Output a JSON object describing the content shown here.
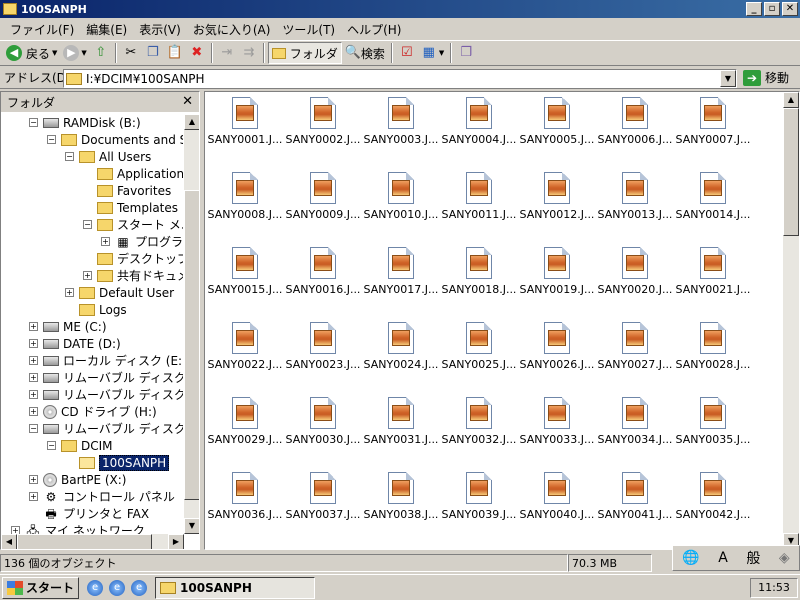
{
  "window": {
    "title": "100SANPH",
    "min": "_",
    "restore": "▫",
    "close": "✕"
  },
  "menu": [
    "ファイル(F)",
    "編集(E)",
    "表示(V)",
    "お気に入り(A)",
    "ツール(T)",
    "ヘルプ(H)"
  ],
  "toolbar": {
    "back": "戻る",
    "folders": "フォルダ",
    "search": "検索"
  },
  "address": {
    "label": "アドレス(D)",
    "value": "I:¥DCIM¥100SANPH",
    "go": "移動"
  },
  "folders_pane": {
    "title": "フォルダ",
    "close": "✕",
    "tree": [
      {
        "label": "RAMDisk (B:)",
        "kind": "drive",
        "exp": "−",
        "level": 1
      },
      {
        "label": "Documents and Set",
        "kind": "folder",
        "exp": "−",
        "level": 2
      },
      {
        "label": "All Users",
        "kind": "folder",
        "exp": "−",
        "level": 3
      },
      {
        "label": "Application",
        "kind": "folder",
        "exp": "",
        "level": 4
      },
      {
        "label": "Favorites",
        "kind": "folder",
        "exp": "",
        "level": 4
      },
      {
        "label": "Templates",
        "kind": "folder",
        "exp": "",
        "level": 4
      },
      {
        "label": "スタート メニュ",
        "kind": "folder",
        "exp": "−",
        "level": 4
      },
      {
        "label": "プログラム",
        "kind": "programs",
        "exp": "+",
        "level": 5
      },
      {
        "label": "デスクトップ",
        "kind": "folder",
        "exp": "",
        "level": 4
      },
      {
        "label": "共有ドキュメ",
        "kind": "folder",
        "exp": "+",
        "level": 4
      },
      {
        "label": "Default User",
        "kind": "folder",
        "exp": "+",
        "level": 3
      },
      {
        "label": "Logs",
        "kind": "folder",
        "exp": "",
        "level": 3
      },
      {
        "label": "ME (C:)",
        "kind": "drive",
        "exp": "+",
        "level": 1
      },
      {
        "label": "DATE (D:)",
        "kind": "drive",
        "exp": "+",
        "level": 1
      },
      {
        "label": "ローカル ディスク (E:)",
        "kind": "drive",
        "exp": "+",
        "level": 1
      },
      {
        "label": "リムーバブル ディスク (F:)",
        "kind": "drive",
        "exp": "+",
        "level": 1
      },
      {
        "label": "リムーバブル ディスク (G:)",
        "kind": "drive",
        "exp": "+",
        "level": 1
      },
      {
        "label": "CD ドライブ (H:)",
        "kind": "cd",
        "exp": "+",
        "level": 1
      },
      {
        "label": "リムーバブル ディスク (I:)",
        "kind": "drive",
        "exp": "−",
        "level": 1
      },
      {
        "label": "DCIM",
        "kind": "folder",
        "exp": "−",
        "level": 2
      },
      {
        "label": "100SANPH",
        "kind": "folder-open",
        "exp": "",
        "level": 3,
        "selected": true
      },
      {
        "label": "BartPE (X:)",
        "kind": "cd",
        "exp": "+",
        "level": 1
      },
      {
        "label": "コントロール パネル",
        "kind": "control",
        "exp": "+",
        "level": 1
      },
      {
        "label": "プリンタと FAX",
        "kind": "printer",
        "exp": "",
        "level": 1
      },
      {
        "label": "マイ ネットワーク",
        "kind": "network",
        "exp": "+",
        "level": 0
      }
    ]
  },
  "files": [
    "SANY0001.J...",
    "SANY0002.J...",
    "SANY0003.J...",
    "SANY0004.J...",
    "SANY0005.J...",
    "SANY0006.J...",
    "SANY0007.J...",
    "SANY0008.J...",
    "SANY0009.J...",
    "SANY0010.J...",
    "SANY0011.J...",
    "SANY0012.J...",
    "SANY0013.J...",
    "SANY0014.J...",
    "SANY0015.J...",
    "SANY0016.J...",
    "SANY0017.J...",
    "SANY0018.J...",
    "SANY0019.J...",
    "SANY0020.J...",
    "SANY0021.J...",
    "SANY0022.J...",
    "SANY0023.J...",
    "SANY0024.J...",
    "SANY0025.J...",
    "SANY0026.J...",
    "SANY0027.J...",
    "SANY0028.J...",
    "SANY0029.J...",
    "SANY0030.J...",
    "SANY0031.J...",
    "SANY0032.J...",
    "SANY0033.J...",
    "SANY0034.J...",
    "SANY0035.J...",
    "SANY0036.J...",
    "SANY0037.J...",
    "SANY0038.J...",
    "SANY0039.J...",
    "SANY0040.J...",
    "SANY0041.J...",
    "SANY0042.J..."
  ],
  "status": {
    "count": "136 個のオブジェクト",
    "size": "70.3 MB"
  },
  "ime": [
    "A",
    "般"
  ],
  "taskbar": {
    "start": "スタート",
    "task": "100SANPH",
    "clock": "11:53"
  }
}
